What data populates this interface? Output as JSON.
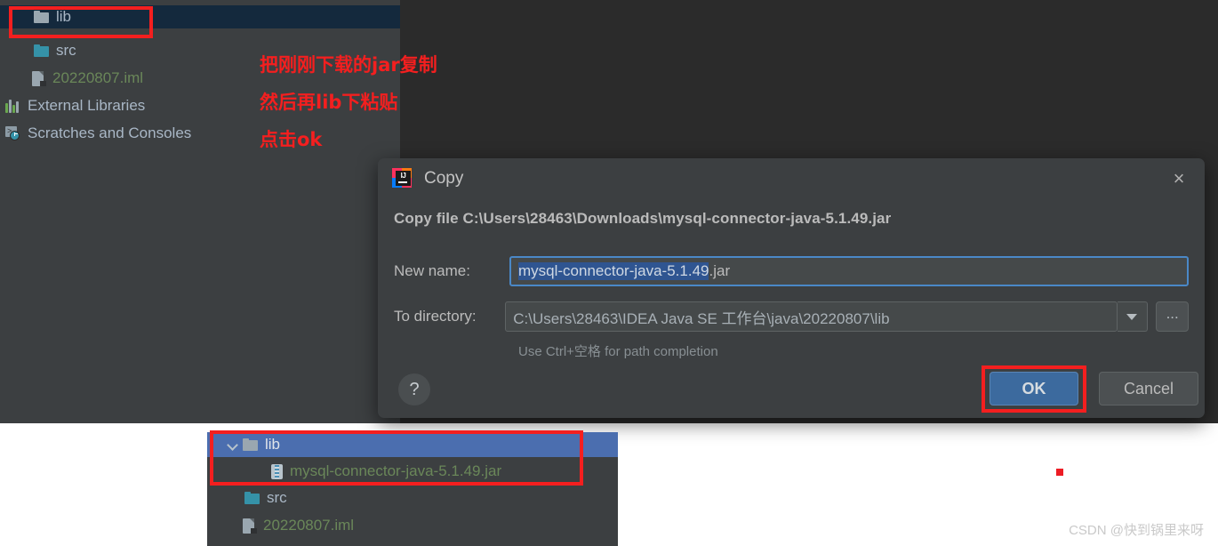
{
  "ide": {
    "project_tree": [
      {
        "label": "lib",
        "icon": "folder-icon",
        "color": "default",
        "selected": true,
        "indent": 38
      },
      {
        "label": "src",
        "icon": "folder-icon",
        "color": "default",
        "selected": false,
        "indent": 38
      },
      {
        "label": "20220807.iml",
        "icon": "iml-file-icon",
        "color": "green",
        "selected": false,
        "indent": 38
      },
      {
        "label": "External Libraries",
        "icon": "external-libraries-icon",
        "color": "default",
        "selected": false,
        "indent": 8
      },
      {
        "label": "Scratches and Consoles",
        "icon": "scratches-icon",
        "color": "default",
        "selected": false,
        "indent": 8
      }
    ]
  },
  "annotations": {
    "line1": "把刚刚下载的jar复制",
    "line2": "然后再lib下粘贴",
    "line3": "点击ok",
    "color": "#f41f1f"
  },
  "dialog": {
    "title": "Copy",
    "app_icon": "intellij-idea-icon",
    "close_icon": "×",
    "headline": "Copy file C:\\Users\\28463\\Downloads\\mysql-connector-java-5.1.49.jar",
    "new_name": {
      "label": "New name:",
      "value_selected": "mysql-connector-java-5.1.49",
      "value_tail": ".jar",
      "full_value": "mysql-connector-java-5.1.49.jar"
    },
    "to_directory": {
      "label": "To directory:",
      "value": "C:\\Users\\28463\\IDEA Java SE 工作台\\java\\20220807\\lib",
      "dropdown_icon": "chevron-down-icon",
      "browse_label": "..."
    },
    "hint": "Use Ctrl+空格 for path completion",
    "help_label": "?",
    "ok_label": "OK",
    "cancel_label": "Cancel",
    "ok_accent": "#3c6a9e"
  },
  "result_tree": [
    {
      "label": "lib",
      "icon": "folder-icon",
      "color": "default",
      "selected": true,
      "expanded": true,
      "indent": 22
    },
    {
      "label": "mysql-connector-java-5.1.49.jar",
      "icon": "jar-file-icon",
      "color": "green",
      "selected": false,
      "expanded": false,
      "indent": 72
    },
    {
      "label": "src",
      "icon": "folder-icon",
      "color": "default",
      "selected": false,
      "expanded": false,
      "indent": 42
    },
    {
      "label": "20220807.iml",
      "icon": "iml-file-icon",
      "color": "green",
      "selected": false,
      "expanded": false,
      "indent": 42
    }
  ],
  "watermark": "CSDN @快到锅里来呀"
}
